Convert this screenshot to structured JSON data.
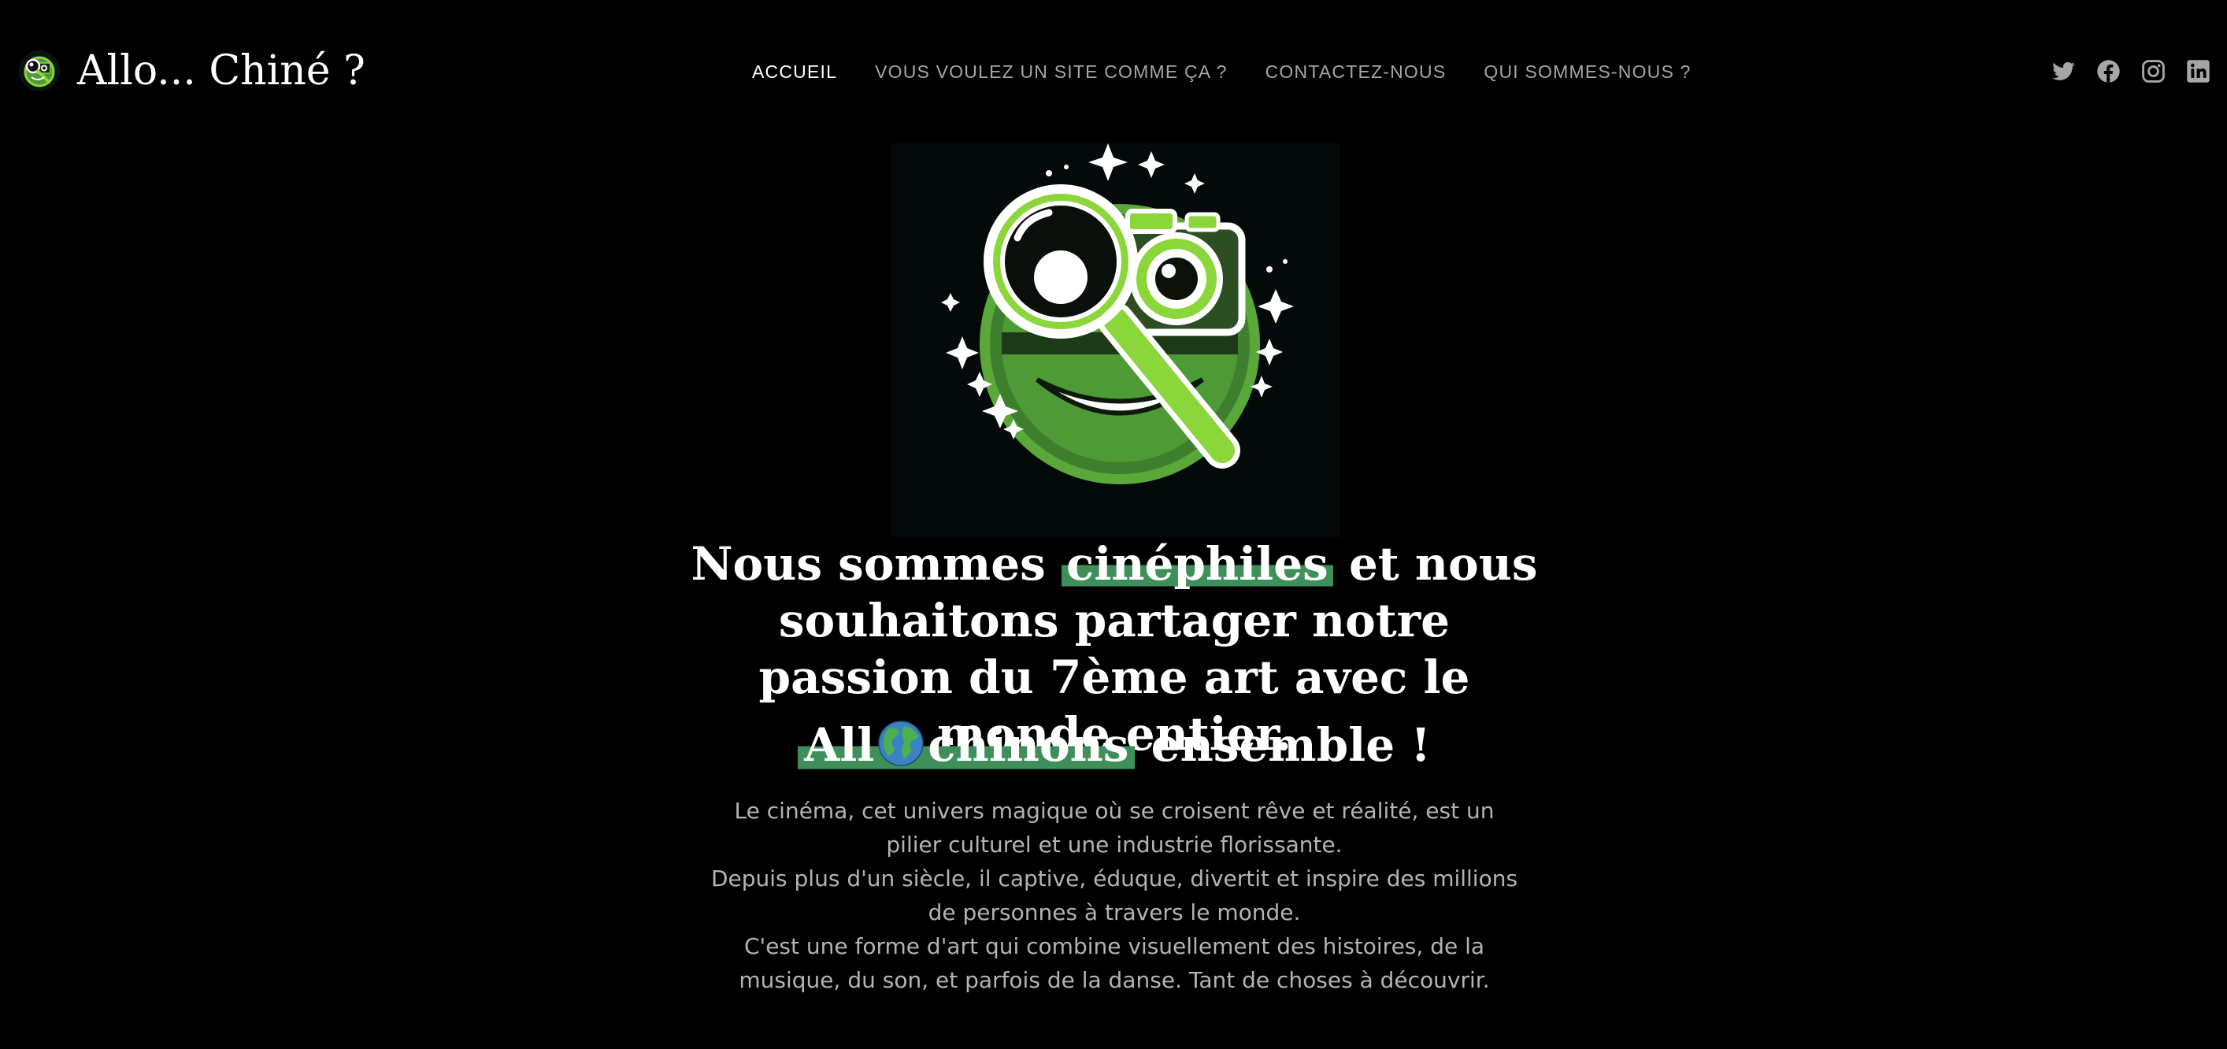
{
  "header": {
    "brand_name": "Allo... Chiné ?",
    "logo_icon": "magnifier-camera-logo-icon",
    "nav": [
      {
        "label": "ACCUEIL",
        "active": true
      },
      {
        "label": "VOUS VOULEZ UN SITE COMME ÇA ?",
        "active": false
      },
      {
        "label": "CONTACTEZ-NOUS",
        "active": false
      },
      {
        "label": "QUI SOMMES-NOUS ?",
        "active": false
      }
    ],
    "socials": [
      "twitter-icon",
      "facebook-icon",
      "instagram-icon",
      "linkedin-icon"
    ]
  },
  "hero": {
    "image_icon": "magnifier-camera-smiley-illustration",
    "headline": {
      "part1": "Nous sommes ",
      "highlight": "cinéphiles",
      "part2": " et nous souhaitons partager notre passion du 7ème art avec le monde entier."
    },
    "tagline": {
      "hl_before": "All",
      "globe_icon": "globe-icon",
      "hl_after": "chinons",
      "rest": " ensemble !"
    },
    "paragraphs": [
      "Le cinéma, cet univers magique où se croisent rêve et réalité, est un pilier culturel et une industrie florissante.",
      "Depuis plus d'un siècle, il captive, éduque, divertit et inspire des millions de personnes à travers le monde.",
      "C'est une forme d'art qui combine visuellement des histoires, de la musique, du son, et parfois de la danse. Tant de choses à découvrir."
    ]
  },
  "colors": {
    "background": "#000000",
    "accent_green": "#3f8f5a",
    "logo_green": "#8bd63a",
    "nav_inactive": "#a6a6a6",
    "body_text": "#b3b3b3"
  }
}
